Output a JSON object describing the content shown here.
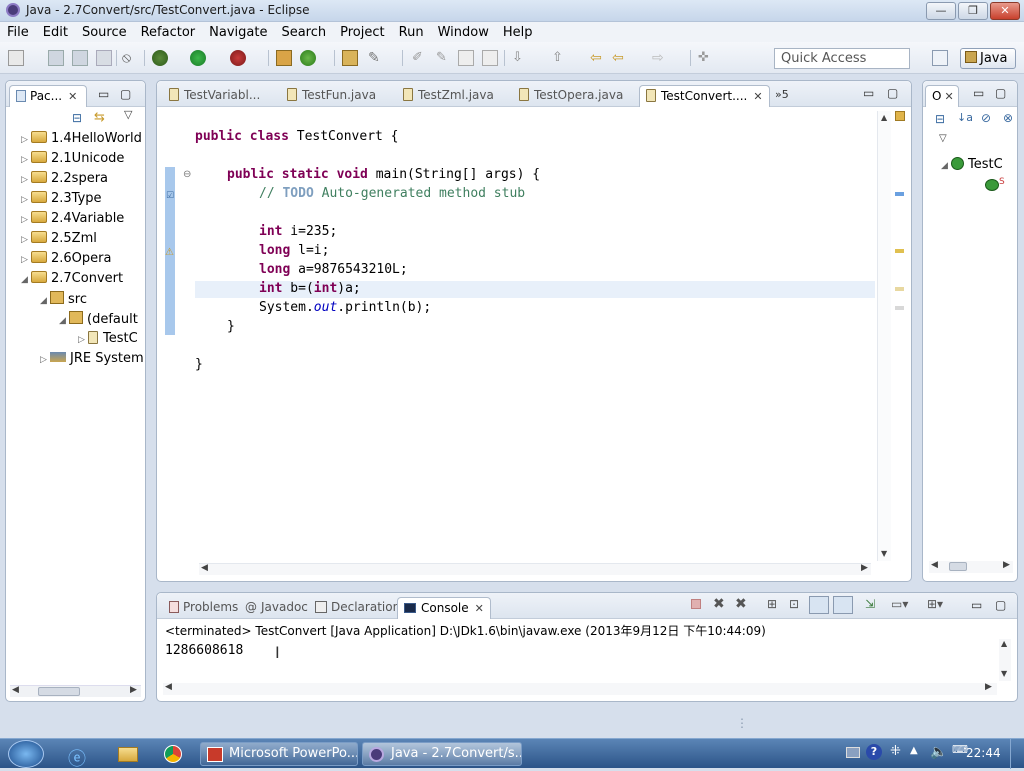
{
  "window": {
    "title": "Java - 2.7Convert/src/TestConvert.java - Eclipse"
  },
  "menu": [
    "File",
    "Edit",
    "Source",
    "Refactor",
    "Navigate",
    "Search",
    "Project",
    "Run",
    "Window",
    "Help"
  ],
  "toolbar": {
    "quick_access_placeholder": "Quick Access",
    "perspective": "Java"
  },
  "package_explorer": {
    "tab_label": "Pac...",
    "items": [
      "1.4HelloWorld",
      "2.1Unicode",
      "2.2spera",
      "2.3Type",
      "2.4Variable",
      "2.5Zml",
      "2.6Opera",
      "2.7Convert",
      "src",
      "(default",
      "TestC",
      "JRE System"
    ]
  },
  "editor": {
    "tabs": [
      "TestVariabl...",
      "TestFun.java",
      "TestZml.java",
      "TestOpera.java",
      "TestConvert...."
    ],
    "overflow": "»5",
    "code": {
      "class_kw": "public class",
      "class_rest": " TestConvert {",
      "method_kw": "public static void",
      "method_rest": " main(String[] args) {",
      "comment_a": "// ",
      "comment_todo": "TODO",
      "comment_b": " Auto-generated method stub",
      "l1_kw": "int",
      "l1_rest": " i=235;",
      "l2_kw": "long",
      "l2_rest": " l=i;",
      "l3_kw": "long",
      "l3_rest": " a=9876543210L;",
      "l4_kw": "int",
      "l4_a": " b=(",
      "l4_kw2": "int",
      "l4_b": ")a;",
      "l5_a": "System.",
      "l5_out": "out",
      "l5_b": ".println(b);",
      "close_method": "}",
      "close_class": "}"
    }
  },
  "outline": {
    "tab_label": "O",
    "item": "TestC"
  },
  "bottom": {
    "tabs": [
      "Problems",
      "Javadoc",
      "Declaration",
      "Console"
    ],
    "console_header": "<terminated> TestConvert [Java Application] D:\\JDk1.6\\bin\\javaw.exe (2013年9月12日 下午10:44:09)",
    "console_output": "1286608618"
  },
  "taskbar": {
    "items": [
      "Microsoft PowerPo...",
      "Java - 2.7Convert/s..."
    ],
    "clock": "22:44"
  },
  "colors": {
    "keyword": "#7f0055",
    "comment": "#3f7f5f",
    "field": "#0000c0"
  }
}
